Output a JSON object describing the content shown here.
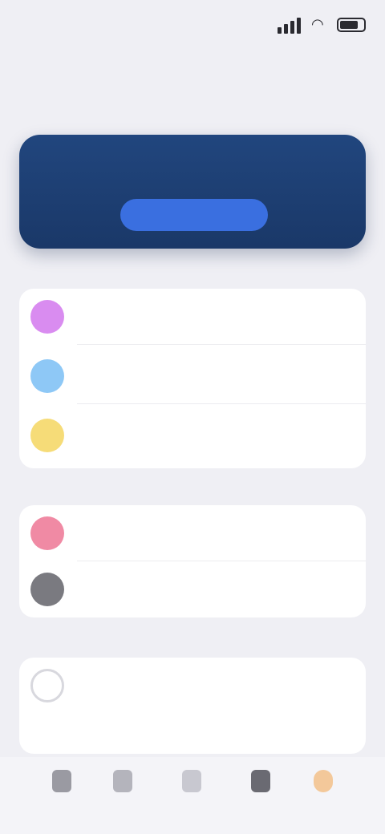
{
  "status_bar": {
    "time": "",
    "wifi_icon": "wifi-icon",
    "battery_icon": "battery-icon"
  },
  "header": {
    "title": ""
  },
  "banner": {
    "text": "",
    "button_label": ""
  },
  "groups": [
    {
      "items": [
        {
          "label": "",
          "sublabel": "",
          "icon": "purple-circle-icon",
          "color": "#d98cf0"
        },
        {
          "label": "",
          "sublabel": "",
          "icon": "blue-circle-icon",
          "color": "#8ec8f6"
        },
        {
          "label": "",
          "sublabel": "",
          "icon": "yellow-circle-icon",
          "color": "#f6dc78"
        }
      ]
    },
    {
      "items": [
        {
          "label": "",
          "icon": "pink-circle-icon",
          "color": "#f08aa4"
        },
        {
          "label": "",
          "icon": "gray-circle-icon",
          "color": "#7a7a80"
        }
      ]
    },
    {
      "items": [
        {
          "label": "",
          "right_text": "",
          "icon": "gray-outline-icon",
          "color": "#d8d8de"
        }
      ]
    }
  ],
  "tab_bar": {
    "tabs": [
      {
        "label": "",
        "icon": "tab-1-icon",
        "color": "#9a9aa2"
      },
      {
        "label": "",
        "icon": "tab-2-icon",
        "color": "#b4b4bc"
      },
      {
        "label": "",
        "icon": "tab-3-icon",
        "color": "#c8c8d0"
      },
      {
        "label": "",
        "icon": "tab-4-icon",
        "color": "#6a6a72"
      },
      {
        "label": "",
        "icon": "tab-5-icon",
        "color": "#f3c89a"
      }
    ]
  },
  "colors": {
    "background": "#efeff4",
    "banner": "#21467e",
    "banner_button": "#3a6fe0"
  }
}
